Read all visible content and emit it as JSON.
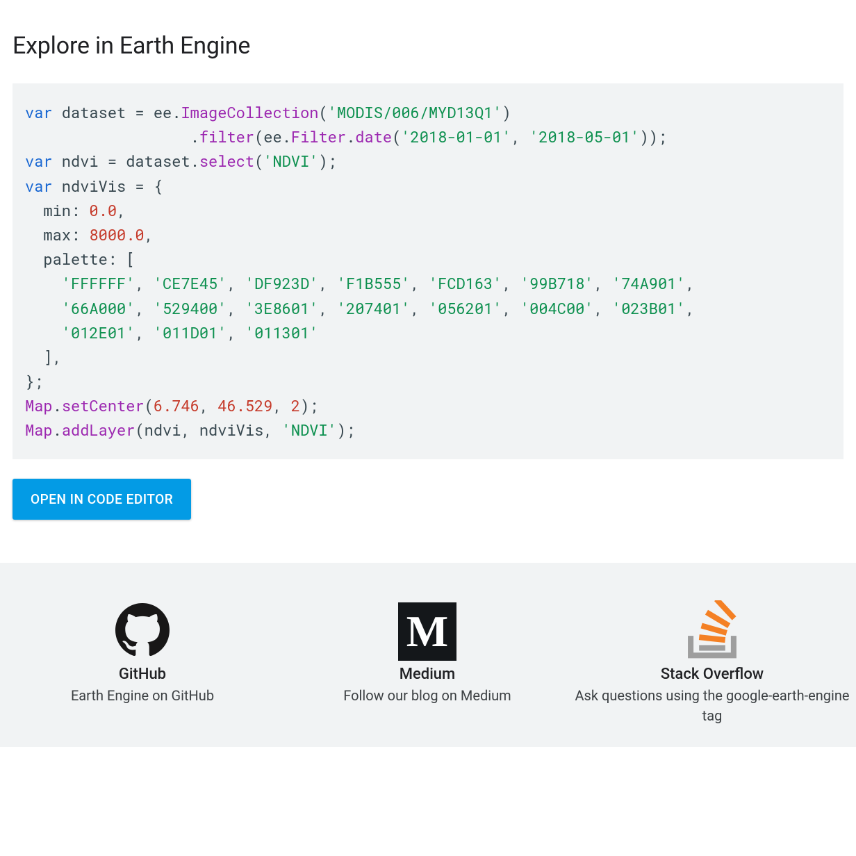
{
  "heading": "Explore in Earth Engine",
  "open_button": "OPEN IN CODE EDITOR",
  "code": {
    "dataset_id": "'MODIS/006/MYD13Q1'",
    "date_start": "'2018-01-01'",
    "date_end": "'2018-05-01'",
    "select_band": "'NDVI'",
    "min": "0.0",
    "max": "8000.0",
    "palette_row1": [
      "'FFFFFF'",
      "'CE7E45'",
      "'DF923D'",
      "'F1B555'",
      "'FCD163'",
      "'99B718'",
      "'74A901'"
    ],
    "palette_row2": [
      "'66A000'",
      "'529400'",
      "'3E8601'",
      "'207401'",
      "'056201'",
      "'004C00'",
      "'023B01'"
    ],
    "palette_row3": [
      "'012E01'",
      "'011D01'",
      "'011301'"
    ],
    "center_lon": "6.746",
    "center_lat": "46.529",
    "center_zoom": "2",
    "layer_name": "'NDVI'"
  },
  "footer": {
    "github": {
      "title": "GitHub",
      "sub": "Earth Engine on GitHub"
    },
    "medium": {
      "title": "Medium",
      "sub": "Follow our blog on Medium",
      "glyph": "M"
    },
    "so": {
      "title": "Stack Overflow",
      "sub": "Ask questions using the google-earth-engine tag"
    }
  }
}
